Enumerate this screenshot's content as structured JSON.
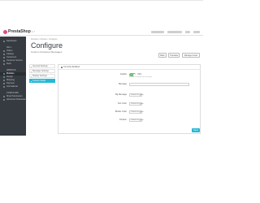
{
  "app": {
    "logo_text": "PrestaShop",
    "version": "1.7"
  },
  "sidebar": {
    "items": [
      {
        "label": "Dashboard"
      },
      {
        "label": "SELL",
        "head": true
      },
      {
        "label": "Orders"
      },
      {
        "label": "Catalog"
      },
      {
        "label": "Customers"
      },
      {
        "label": "Customer Service"
      },
      {
        "label": "Stats"
      },
      {
        "label": "IMPROVE",
        "head": true
      },
      {
        "label": "Modules",
        "active": true
      },
      {
        "label": "Design"
      },
      {
        "label": "Shipping"
      },
      {
        "label": "Payment"
      },
      {
        "label": "International"
      },
      {
        "label": "CONFIGURE",
        "head": true
      },
      {
        "label": "Shop Parameters"
      },
      {
        "label": "Advanced Parameters"
      }
    ]
  },
  "header": {
    "breadcrumb": "Modules / Module / Configure",
    "title": "Configure",
    "subtitle": "Custom Checkout Messages",
    "buttons": [
      "Back",
      "Translate",
      "Manage hooks"
    ]
  },
  "subnav": {
    "items": [
      {
        "label": "General Settings"
      },
      {
        "label": "Message Settings"
      },
      {
        "label": "Display Settings"
      },
      {
        "label": "Custom Fields",
        "active": true
      }
    ]
  },
  "panel": {
    "title": "Currently Enabled",
    "fields": [
      {
        "label": "Enable",
        "type": "toggle",
        "value": "YES",
        "hint": "Enable or disable this message"
      },
      {
        "label": "Message",
        "type": "text",
        "value": ""
      },
      {
        "label": "Bg Message",
        "type": "select",
        "value": "Choose an option"
      },
      {
        "label": "Text Color",
        "type": "select",
        "value": "Choose an option"
      },
      {
        "label": "Border Color",
        "type": "select",
        "value": "Choose an option"
      },
      {
        "label": "Position",
        "type": "select",
        "value": "Choose an option"
      }
    ],
    "save_label": "Save"
  },
  "colors": {
    "sidebar_bg": "#363a41",
    "accent": "#25b9d7",
    "toggle_on": "#72c279"
  }
}
